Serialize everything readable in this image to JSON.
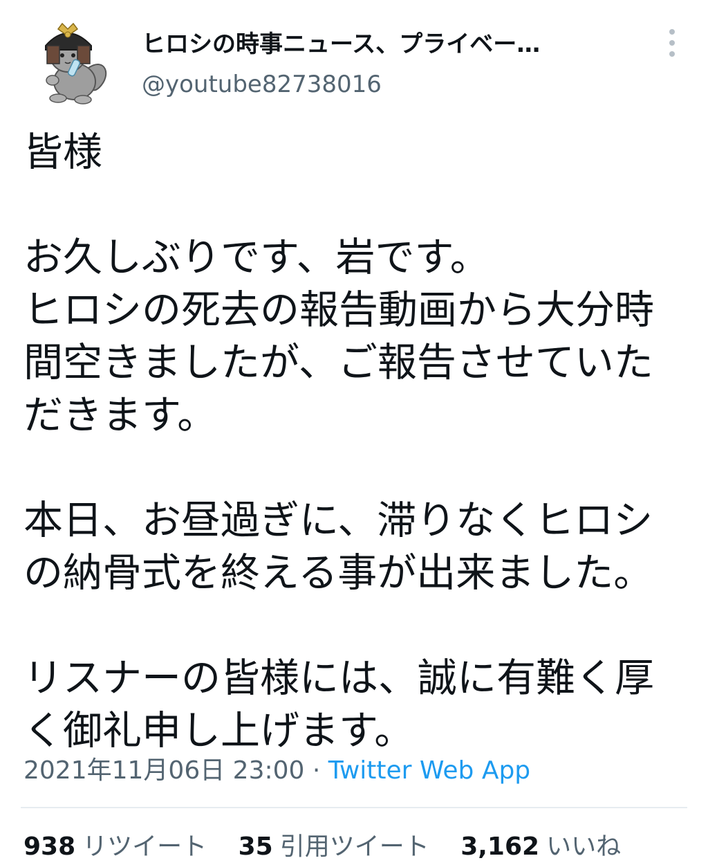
{
  "author": {
    "display_name": "ヒロシの時事ニュース、プライベー…",
    "handle": "@youtube82738016",
    "avatar_icon": "samurai-cat-avatar-icon"
  },
  "more_icon": "more-vertical-icon",
  "tweet": {
    "paragraphs": [
      [
        "皆様"
      ],
      [
        "お久しぶりです、岩です。",
        "ヒロシの死去の報告動画から大分時",
        "間空きましたが、ご報告させていた",
        "だきます。"
      ],
      [
        "本日、お昼過ぎに、滞りなくヒロシ",
        "の納骨式を終える事が出来ました。"
      ],
      [
        "リスナーの皆様には、誠に有難く厚",
        "く御礼申し上げます。"
      ]
    ]
  },
  "meta": {
    "timestamp": "2021年11月06日 23:00",
    "separator": "·",
    "source": "Twitter Web App"
  },
  "stats": {
    "retweets_count": "938",
    "retweets_label": "リツイート",
    "quotes_count": "35",
    "quotes_label": "引用ツイート",
    "likes_count": "3,162",
    "likes_label": "いいね"
  },
  "colors": {
    "text": "#0f1419",
    "secondary": "#536471",
    "link": "#1d9bf0"
  }
}
